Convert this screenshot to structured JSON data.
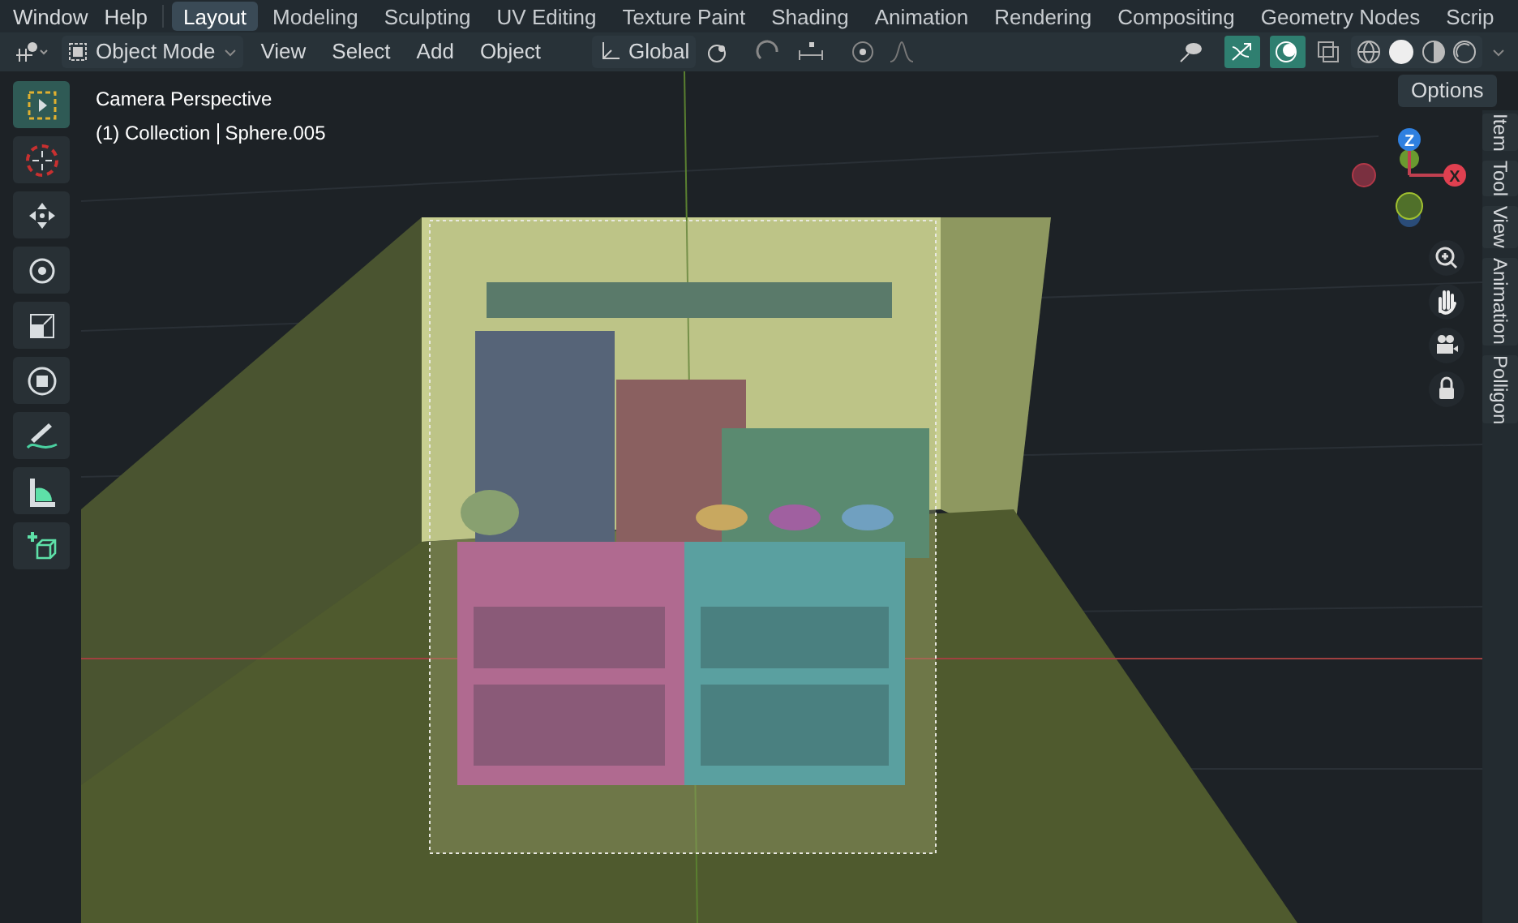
{
  "menu": [
    "Window",
    "Help"
  ],
  "workspaces": [
    {
      "label": "Layout",
      "selected": true
    },
    {
      "label": "Modeling",
      "selected": false
    },
    {
      "label": "Sculpting",
      "selected": false
    },
    {
      "label": "UV Editing",
      "selected": false
    },
    {
      "label": "Texture Paint",
      "selected": false
    },
    {
      "label": "Shading",
      "selected": false
    },
    {
      "label": "Animation",
      "selected": false
    },
    {
      "label": "Rendering",
      "selected": false
    },
    {
      "label": "Compositing",
      "selected": false
    },
    {
      "label": "Geometry Nodes",
      "selected": false
    },
    {
      "label": "Scrip",
      "selected": false
    }
  ],
  "header": {
    "mode": "Object Mode",
    "menus": [
      "View",
      "Select",
      "Add",
      "Object"
    ],
    "orientation": "Global"
  },
  "options": "Options",
  "viewport": {
    "title": "Camera Perspective",
    "collection": "(1) Collection",
    "object": "Sphere.005"
  },
  "tools": [
    {
      "kind": "select",
      "selected": true
    },
    {
      "kind": "cursor",
      "selected": false
    },
    {
      "kind": "move",
      "selected": false
    },
    {
      "kind": "rotate",
      "selected": false
    },
    {
      "kind": "scale",
      "selected": false
    },
    {
      "kind": "transform",
      "selected": false
    },
    {
      "kind": "annotate",
      "selected": false
    },
    {
      "kind": "measure",
      "selected": false
    },
    {
      "kind": "add-cube",
      "selected": false
    }
  ],
  "gizmo": {
    "z": "Z",
    "x": "X"
  },
  "sidebar_tabs": [
    "Item",
    "Tool",
    "View",
    "Animation",
    "Polligon"
  ]
}
